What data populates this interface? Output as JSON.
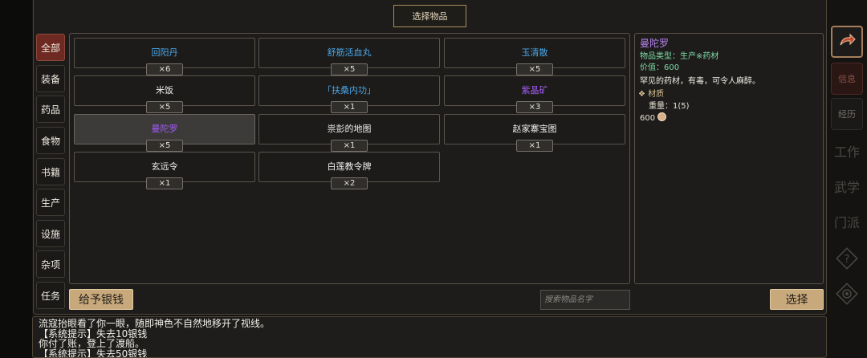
{
  "title": "选择物品",
  "categories": [
    {
      "label": "全部",
      "active": true
    },
    {
      "label": "装备",
      "active": false
    },
    {
      "label": "药品",
      "active": false
    },
    {
      "label": "食物",
      "active": false
    },
    {
      "label": "书籍",
      "active": false
    },
    {
      "label": "生产",
      "active": false
    },
    {
      "label": "设施",
      "active": false
    },
    {
      "label": "杂项",
      "active": false
    },
    {
      "label": "任务",
      "active": false
    }
  ],
  "items": [
    {
      "name": "回阳丹",
      "qty": "×6",
      "color": "#4aa6e8"
    },
    {
      "name": "舒筋活血丸",
      "qty": "×5",
      "color": "#4aa6e8"
    },
    {
      "name": "玉清散",
      "qty": "×5",
      "color": "#4aa6e8"
    },
    {
      "name": "米饭",
      "qty": "×5",
      "color": "#eeeeee"
    },
    {
      "name": "「扶桑内功」",
      "qty": "×1",
      "color": "#4aa6e8"
    },
    {
      "name": "紫晶矿",
      "qty": "×3",
      "color": "#a15bf2"
    },
    {
      "name": "曼陀罗",
      "qty": "×5",
      "color": "#a15bf2",
      "selected": true
    },
    {
      "name": "祟彭的地图",
      "qty": "×1",
      "color": "#eeeeee"
    },
    {
      "name": "赵家寨宝图",
      "qty": "×1",
      "color": "#eeeeee"
    },
    {
      "name": "玄远令",
      "qty": "×1",
      "color": "#eeeeee"
    },
    {
      "name": "白莲教令牌",
      "qty": "×2",
      "color": "#eeeeee"
    }
  ],
  "detail": {
    "name": "曼陀罗",
    "type_line": "物品类型：生产※药材",
    "value_line": "价值：600",
    "desc": "罕见的药材，有毒，可令人麻醉。",
    "section": "材质",
    "weight_line": "重量：1(5)",
    "price": "600"
  },
  "buttons": {
    "give_money": "给予银钱",
    "select": "选择"
  },
  "search": {
    "placeholder": "搜索物品名字"
  },
  "log": [
    "流寇抬眼看了你一眼，随即神色不自然地移开了视线。",
    "【系统提示】失去10银钱",
    "你付了账，登上了渡船。",
    "【系统提示】失去50银钱"
  ],
  "side_labels": {
    "info": "信息",
    "history": "经历",
    "work": "工作",
    "martial": "武学",
    "sect": "门派"
  },
  "colors": {
    "accent_red": "#6e2a22",
    "gold": "#c8a97c",
    "rare_blue": "#4aa6e8",
    "epic_purple": "#a15bf2",
    "detail_green": "#7fd9a6",
    "detail_title": "#b882f2"
  }
}
